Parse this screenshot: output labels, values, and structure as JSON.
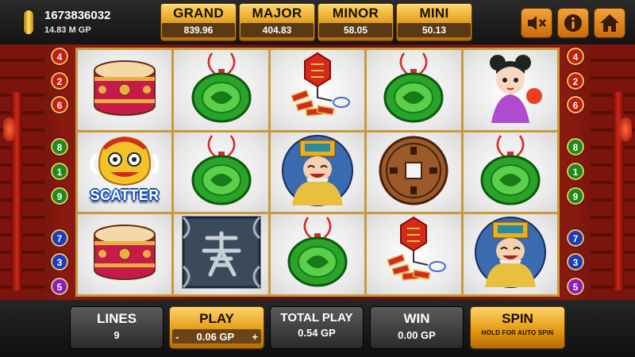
{
  "player": {
    "coin_id": "1673836032",
    "balance": "14.83 M GP"
  },
  "jackpots": [
    {
      "name": "GRAND",
      "value": "839.96"
    },
    {
      "name": "MAJOR",
      "value": "404.83"
    },
    {
      "name": "MINOR",
      "value": "58.05"
    },
    {
      "name": "MINI",
      "value": "50.13"
    }
  ],
  "controls": [
    "mute-icon",
    "info-icon",
    "home-icon"
  ],
  "paylines": {
    "left": [
      "4",
      "2",
      "6",
      "8",
      "1",
      "9",
      "7",
      "3",
      "5"
    ],
    "right": [
      "4",
      "2",
      "6",
      "8",
      "1",
      "9",
      "7",
      "3",
      "5"
    ]
  },
  "reels": [
    [
      "drum",
      "jade",
      "firecracker",
      "jade",
      "girl"
    ],
    [
      "lion",
      "jade",
      "god",
      "coin",
      "jade"
    ],
    [
      "drum",
      "fa-tile",
      "jade",
      "firecracker",
      "god"
    ]
  ],
  "scatter_label": "SCATTER",
  "bottom": {
    "lines_label": "LINES",
    "lines_value": "9",
    "play_label": "PLAY",
    "play_minus": "-",
    "play_value": "0.06 GP",
    "play_plus": "+",
    "total_label": "TOTAL PLAY",
    "total_value": "0.54 GP",
    "win_label": "WIN",
    "win_value": "0.00 GP",
    "spin_label": "SPIN",
    "spin_sub": "HOLD FOR AUTO SPIN"
  },
  "colors": {
    "gold": "#e09a18",
    "reel_border": "#c89a3a",
    "background_red": "#8a1a10"
  }
}
